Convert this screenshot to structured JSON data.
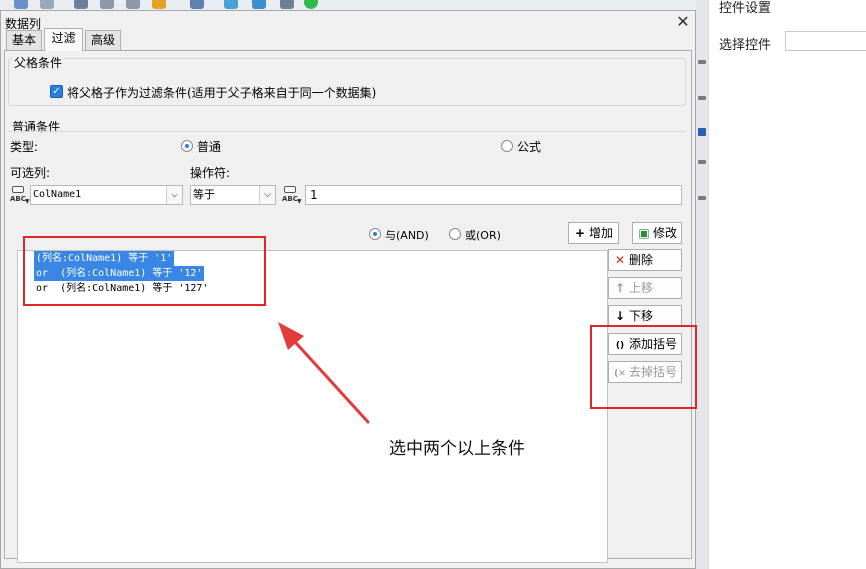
{
  "dialog": {
    "title": "数据列",
    "close_glyph": "✕"
  },
  "tabs": [
    {
      "label": "基本",
      "active": false
    },
    {
      "label": "过滤",
      "active": true
    },
    {
      "label": "高级",
      "active": false
    }
  ],
  "parent_condition": {
    "group_title": "父格条件",
    "checkbox_label": "将父格子作为过滤条件(适用于父子格来自于同一个数据集)",
    "checked": true
  },
  "common_condition": {
    "group_title": "普通条件",
    "type_label": "类型:",
    "type_options": [
      "普通",
      "公式"
    ],
    "type_selected": "普通",
    "column_label": "可选列:",
    "operator_label": "操作符:",
    "column_value": "ColName1",
    "operator_value": "等于",
    "value_input": "1"
  },
  "logic": {
    "and_label": "与(AND)",
    "or_label": "或(OR)",
    "selected": "与(AND)"
  },
  "buttons": {
    "add": "增加",
    "edit": "修改",
    "delete": "删除",
    "move_up": "上移",
    "move_down": "下移",
    "add_paren": "添加括号",
    "remove_paren": "去掉括号"
  },
  "conditions": [
    {
      "text": "(列名:ColName1) 等于 '1'",
      "selected": true
    },
    {
      "text": "or  (列名:ColName1) 等于 '12'",
      "selected": true
    },
    {
      "text": "or  (列名:ColName1) 等于 '127'",
      "selected": false
    }
  ],
  "annotation": "选中两个以上条件",
  "right_panel": {
    "title": "控件设置",
    "select_control_label": "选择控件"
  },
  "colors": {
    "highlight_red": "#e02727",
    "selection_blue": "#3a86e4",
    "accent_blue": "#2b7de0"
  }
}
